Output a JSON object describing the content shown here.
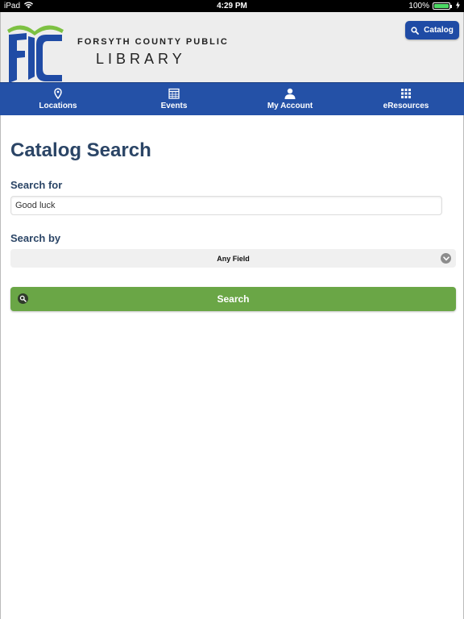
{
  "status_bar": {
    "device": "iPad",
    "time": "4:29 PM",
    "battery_percent": "100%",
    "battery_level": 1.0,
    "icons": [
      "wifi-icon",
      "battery-icon",
      "charging-icon"
    ]
  },
  "header": {
    "logo_line1": "FORSYTH COUNTY PUBLIC",
    "logo_line2": "LIBRARY",
    "catalog_button_label": "Catalog",
    "colors": {
      "logo_green": "#7dc142",
      "logo_blue": "#1f4ba5"
    }
  },
  "nav": {
    "items": [
      {
        "label": "Locations",
        "icon": "map-pin-icon"
      },
      {
        "label": "Events",
        "icon": "calendar-icon"
      },
      {
        "label": "My Account",
        "icon": "user-icon"
      },
      {
        "label": "eResources",
        "icon": "grid-icon"
      }
    ],
    "color": "#2451a7"
  },
  "main": {
    "title": "Catalog Search",
    "search_for_label": "Search for",
    "search_value": "Good luck",
    "search_by_label": "Search by",
    "search_by_selected": "Any Field",
    "search_button_label": "Search",
    "colors": {
      "title": "#2b4566",
      "search_button": "#6aa646"
    }
  }
}
